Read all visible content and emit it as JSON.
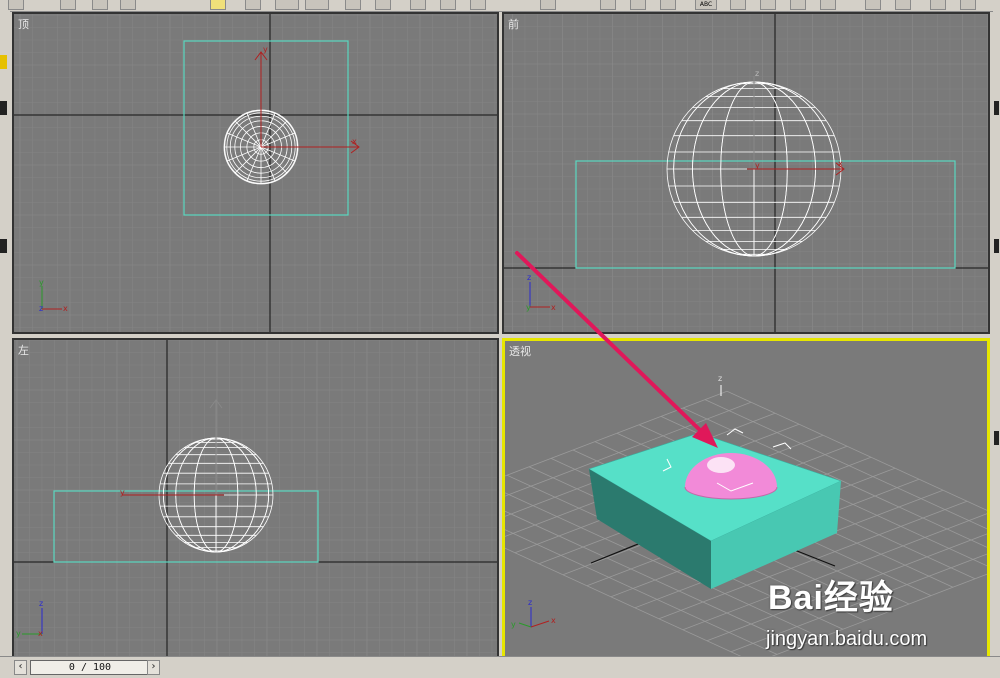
{
  "viewports": {
    "top": {
      "label": "顶"
    },
    "front": {
      "label": "前"
    },
    "left": {
      "label": "左"
    },
    "perspective": {
      "label": "透视"
    }
  },
  "axes": {
    "x": "x",
    "y": "y",
    "z": "z"
  },
  "timeline": {
    "frame_text": "0 / 100",
    "prev_icon": "chevron-left-icon",
    "next_icon": "chevron-right-icon"
  },
  "toolbar": {
    "abc_label": "ABC"
  },
  "watermark": {
    "brand": "Bai经验",
    "url": "jingyan.baidu.com"
  },
  "colors": {
    "viewport_bg": "#7a7a7a",
    "active_border": "#e6e600",
    "box_wire": "#5ad8c0",
    "box_solid": "#4fd9c2",
    "sphere_wire": "#ffffff",
    "hemisphere": "#f28ad8",
    "arrow": "#e0185a",
    "gizmo_red": "#b02020"
  }
}
